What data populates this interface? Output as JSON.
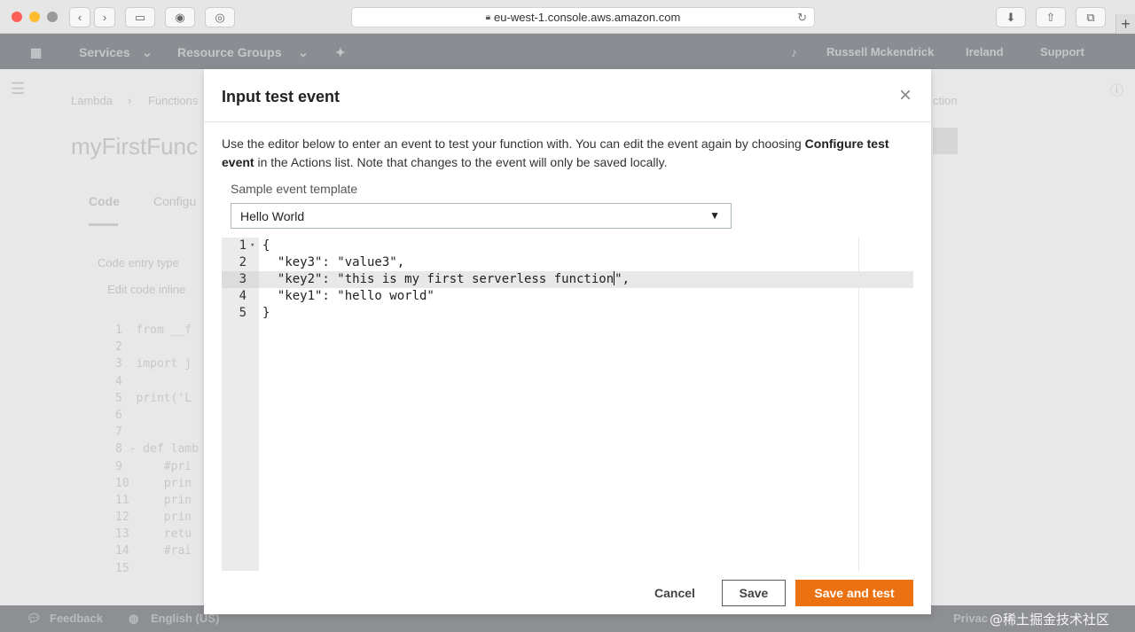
{
  "browser": {
    "url": "eu-west-1.console.aws.amazon.com",
    "new_tab": "+"
  },
  "aws_nav": {
    "services": "Services",
    "resource_groups": "Resource Groups",
    "user": "Russell Mckendrick",
    "region": "Ireland",
    "support": "Support"
  },
  "page": {
    "breadcrumb_1": "Lambda",
    "breadcrumb_2": "Functions",
    "breadcrumb_right": "ction",
    "title": "myFirstFunc",
    "tab_code": "Code",
    "tab_config": "Configu",
    "code_entry_label": "Code entry type",
    "code_entry_value": "Edit code inline",
    "bg_code": [
      "1  from __f",
      "2",
      "3  import j",
      "4",
      "5  print('L",
      "6",
      "7",
      "8 - def lamb",
      "9      #pri",
      "10     prin",
      "11     prin",
      "12     prin",
      "13     retu",
      "14     #rai",
      "15"
    ]
  },
  "modal": {
    "title": "Input test event",
    "description_1": "Use the editor below to enter an event to test your function with. You can edit the event again by choosing ",
    "description_bold_1": "Configure test event",
    "description_2": " in the Actions list. Note that changes to the event will only be saved locally.",
    "template_label": "Sample event template",
    "template_value": "Hello World",
    "editor": {
      "line_numbers": [
        "1",
        "2",
        "3",
        "4",
        "5"
      ],
      "lines": [
        "{",
        "  \"key3\": \"value3\",",
        "  \"key2\": \"this is my first serverless function",
        "  \"key1\": \"hello world\"",
        "}"
      ],
      "line3_tail": "\","
    },
    "cancel_label": "Cancel",
    "save_label": "Save",
    "save_test_label": "Save and test"
  },
  "footer": {
    "feedback": "Feedback",
    "language": "English (US)",
    "privacy": "Privac"
  },
  "watermark": "@稀土掘金技术社区"
}
